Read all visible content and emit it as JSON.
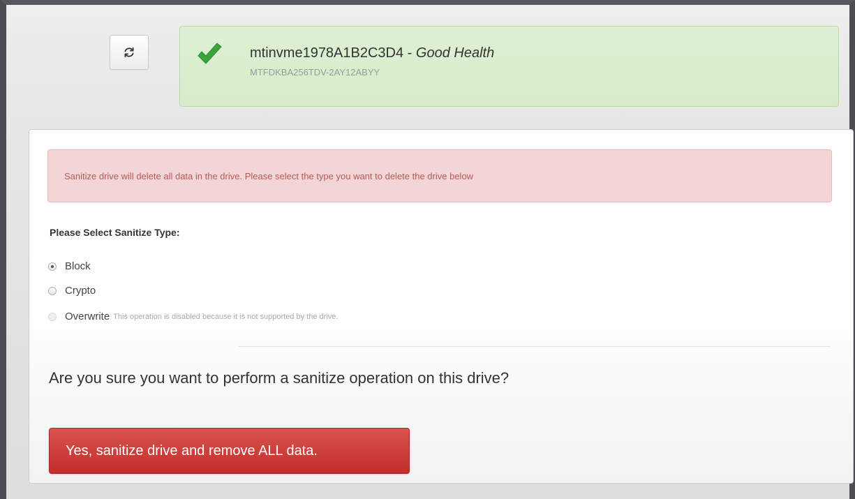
{
  "header": {
    "refresh_icon": "refresh-icon",
    "drive": {
      "status_icon": "checkmark-icon",
      "name": "mtinvme1978A1B2C3D4",
      "separator": " - ",
      "health": "Good Health",
      "model": "MTFDKBA256TDV-2AY12ABYY"
    }
  },
  "sanitize": {
    "warning": "Sanitize drive will delete all data in the drive. Please select the type you want to delete the drive below",
    "select_label": "Please Select Sanitize Type:",
    "options": [
      {
        "label": "Block",
        "checked": true,
        "disabled": false,
        "note": ""
      },
      {
        "label": "Crypto",
        "checked": false,
        "disabled": false,
        "note": ""
      },
      {
        "label": "Overwrite",
        "checked": false,
        "disabled": true,
        "note": "This operation is disabled because it is not supported by the drive."
      }
    ],
    "question": "Are you sure you want to perform a sanitize operation on this drive?",
    "confirm_button": "Yes, sanitize drive and remove ALL data."
  },
  "colors": {
    "success_bg": "#dff0d4",
    "success_check": "#3aa33a",
    "danger_bg": "#f3d5d5",
    "danger_text": "#b45a5a",
    "danger_button": "#d9534f"
  }
}
